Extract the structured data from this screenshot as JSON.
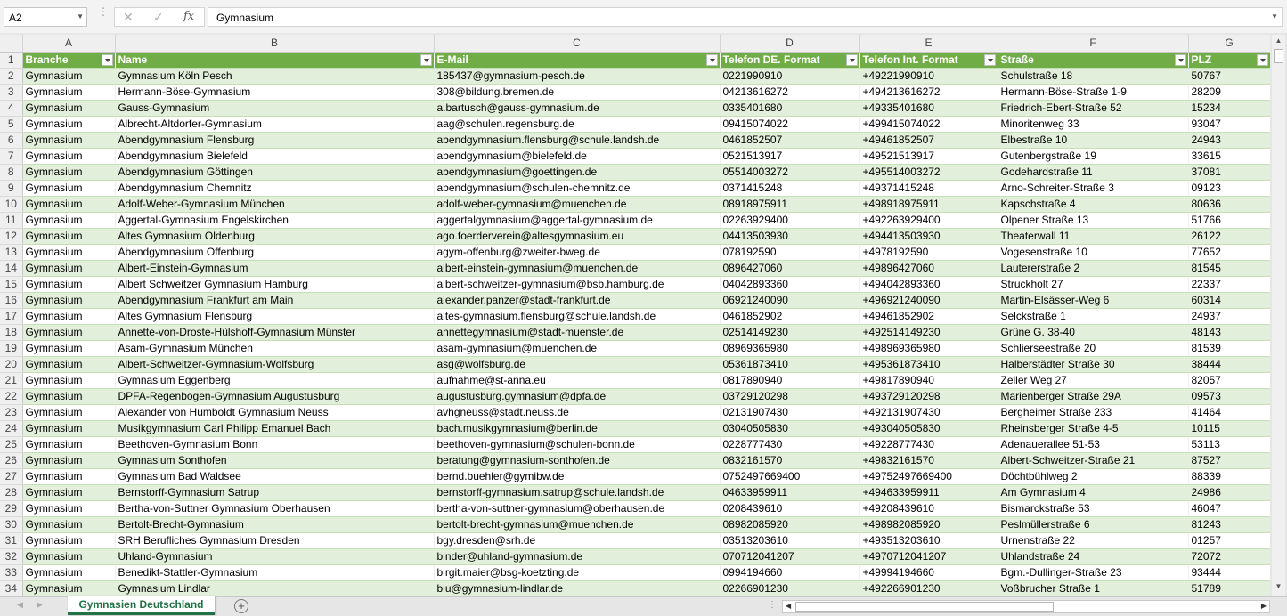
{
  "name_box": "A2",
  "formula": "Gymnasium",
  "column_letters": [
    "A",
    "B",
    "C",
    "D",
    "E",
    "F",
    "G"
  ],
  "headers": [
    "Branche",
    "Name",
    "E-Mail",
    "Telefon DE. Format",
    "Telefon Int. Format",
    "Straße",
    "PLZ"
  ],
  "rows": [
    {
      "n": "2",
      "cells": [
        "Gymnasium",
        "Gymnasium Köln Pesch",
        "185437@gymnasium-pesch.de",
        "0221990910",
        "+49221990910",
        "Schulstraße 18",
        "50767"
      ]
    },
    {
      "n": "3",
      "cells": [
        "Gymnasium",
        "Hermann-Böse-Gymnasium",
        "308@bildung.bremen.de",
        "04213616272",
        "+494213616272",
        "Hermann-Böse-Straße 1-9",
        "28209"
      ]
    },
    {
      "n": "4",
      "cells": [
        "Gymnasium",
        "Gauss-Gymnasium",
        "a.bartusch@gauss-gymnasium.de",
        "0335401680",
        "+49335401680",
        "Friedrich-Ebert-Straße 52",
        "15234"
      ]
    },
    {
      "n": "5",
      "cells": [
        "Gymnasium",
        "Albrecht-Altdorfer-Gymnasium",
        "aag@schulen.regensburg.de",
        "09415074022",
        "+499415074022",
        "Minoritenweg 33",
        "93047"
      ]
    },
    {
      "n": "6",
      "cells": [
        "Gymnasium",
        "Abendgymnasium Flensburg",
        "abendgymnasium.flensburg@schule.landsh.de",
        "0461852507",
        "+49461852507",
        "Elbestraße 10",
        "24943"
      ]
    },
    {
      "n": "7",
      "cells": [
        "Gymnasium",
        "Abendgymnasium Bielefeld",
        "abendgymnasium@bielefeld.de",
        "0521513917",
        "+49521513917",
        "Gutenbergstraße 19",
        "33615"
      ]
    },
    {
      "n": "8",
      "cells": [
        "Gymnasium",
        "Abendgymnasium Göttingen",
        "abendgymnasium@goettingen.de",
        "05514003272",
        "+495514003272",
        "Godehardstraße 11",
        "37081"
      ]
    },
    {
      "n": "9",
      "cells": [
        "Gymnasium",
        "Abendgymnasium Chemnitz",
        "abendgymnasium@schulen-chemnitz.de",
        "0371415248",
        "+49371415248",
        "Arno-Schreiter-Straße 3",
        "09123"
      ]
    },
    {
      "n": "10",
      "cells": [
        "Gymnasium",
        "Adolf-Weber-Gymnasium München",
        "adolf-weber-gymnasium@muenchen.de",
        "08918975911",
        "+498918975911",
        "Kapschstraße 4",
        "80636"
      ]
    },
    {
      "n": "11",
      "cells": [
        "Gymnasium",
        "Aggertal-Gymnasium Engelskirchen",
        "aggertalgymnasium@aggertal-gymnasium.de",
        "02263929400",
        "+492263929400",
        "Olpener Straße 13",
        "51766"
      ]
    },
    {
      "n": "12",
      "cells": [
        "Gymnasium",
        "Altes Gymnasium Oldenburg",
        "ago.foerderverein@altesgymnasium.eu",
        "04413503930",
        "+494413503930",
        "Theaterwall 11",
        "26122"
      ]
    },
    {
      "n": "13",
      "cells": [
        "Gymnasium",
        "Abendgymnasium Offenburg",
        "agym-offenburg@zweiter-bweg.de",
        "078192590",
        "+4978192590",
        "Vogesenstraße 10",
        "77652"
      ]
    },
    {
      "n": "14",
      "cells": [
        "Gymnasium",
        "Albert-Einstein-Gymnasium",
        "albert-einstein-gymnasium@muenchen.de",
        "0896427060",
        "+49896427060",
        "Lautererstraße 2",
        "81545"
      ]
    },
    {
      "n": "15",
      "cells": [
        "Gymnasium",
        "Albert Schweitzer Gymnasium Hamburg",
        "albert-schweitzer-gymnasium@bsb.hamburg.de",
        "04042893360",
        "+494042893360",
        "Struckholt 27",
        "22337"
      ]
    },
    {
      "n": "16",
      "cells": [
        "Gymnasium",
        "Abendgymnasium Frankfurt am Main",
        "alexander.panzer@stadt-frankfurt.de",
        "06921240090",
        "+496921240090",
        "Martin-Elsässer-Weg 6",
        "60314"
      ]
    },
    {
      "n": "17",
      "cells": [
        "Gymnasium",
        "Altes Gymnasium Flensburg",
        "altes-gymnasium.flensburg@schule.landsh.de",
        "0461852902",
        "+49461852902",
        "Selckstraße 1",
        "24937"
      ]
    },
    {
      "n": "18",
      "cells": [
        "Gymnasium",
        "Annette-von-Droste-Hülshoff-Gymnasium Münster",
        "annettegymnasium@stadt-muenster.de",
        "02514149230",
        "+492514149230",
        "Grüne G. 38-40",
        "48143"
      ]
    },
    {
      "n": "19",
      "cells": [
        "Gymnasium",
        "Asam-Gymnasium München",
        "asam-gymnasium@muenchen.de",
        "08969365980",
        "+498969365980",
        "Schlierseestraße 20",
        "81539"
      ]
    },
    {
      "n": "20",
      "cells": [
        "Gymnasium",
        "Albert-Schweitzer-Gymnasium-Wolfsburg",
        "asg@wolfsburg.de",
        "05361873410",
        "+495361873410",
        "Halberstädter Straße 30",
        "38444"
      ]
    },
    {
      "n": "21",
      "cells": [
        "Gymnasium",
        "Gymnasium Eggenberg",
        "aufnahme@st-anna.eu",
        "0817890940",
        "+49817890940",
        "Zeller Weg 27",
        "82057"
      ]
    },
    {
      "n": "22",
      "cells": [
        "Gymnasium",
        "DPFA-Regenbogen-Gymnasium Augustusburg",
        "augustusburg.gymnasium@dpfa.de",
        "03729120298",
        "+493729120298",
        "Marienberger Straße 29A",
        "09573"
      ]
    },
    {
      "n": "23",
      "cells": [
        "Gymnasium",
        "Alexander von Humboldt Gymnasium Neuss",
        "avhgneuss@stadt.neuss.de",
        "02131907430",
        "+492131907430",
        "Bergheimer Straße 233",
        "41464"
      ]
    },
    {
      "n": "24",
      "cells": [
        "Gymnasium",
        "Musikgymnasium Carl Philipp Emanuel Bach",
        "bach.musikgymnasium@berlin.de",
        "03040505830",
        "+493040505830",
        "Rheinsberger Straße 4-5",
        "10115"
      ]
    },
    {
      "n": "25",
      "cells": [
        "Gymnasium",
        "Beethoven-Gymnasium Bonn",
        "beethoven-gymnasium@schulen-bonn.de",
        "0228777430",
        "+49228777430",
        "Adenauerallee 51-53",
        "53113"
      ]
    },
    {
      "n": "26",
      "cells": [
        "Gymnasium",
        "Gymnasium Sonthofen",
        "beratung@gymnasium-sonthofen.de",
        "0832161570",
        "+49832161570",
        "Albert-Schweitzer-Straße 21",
        "87527"
      ]
    },
    {
      "n": "27",
      "cells": [
        "Gymnasium",
        "Gymnasium Bad Waldsee",
        "bernd.buehler@gymibw.de",
        "0752497669400",
        "+49752497669400",
        "Döchtbühlweg 2",
        "88339"
      ]
    },
    {
      "n": "28",
      "cells": [
        "Gymnasium",
        "Bernstorff-Gymnasium Satrup",
        "bernstorff-gymnasium.satrup@schule.landsh.de",
        "04633959911",
        "+494633959911",
        "Am Gymnasium 4",
        "24986"
      ]
    },
    {
      "n": "29",
      "cells": [
        "Gymnasium",
        "Bertha-von-Suttner Gymnasium Oberhausen",
        "bertha-von-suttner-gymnasium@oberhausen.de",
        "0208439610",
        "+49208439610",
        "Bismarckstraße 53",
        "46047"
      ]
    },
    {
      "n": "30",
      "cells": [
        "Gymnasium",
        "Bertolt-Brecht-Gymnasium",
        "bertolt-brecht-gymnasium@muenchen.de",
        "08982085920",
        "+498982085920",
        "Peslmüllerstraße 6",
        "81243"
      ]
    },
    {
      "n": "31",
      "cells": [
        "Gymnasium",
        "SRH Berufliches Gymnasium Dresden",
        "bgy.dresden@srh.de",
        "03513203610",
        "+493513203610",
        "Urnenstraße 22",
        "01257"
      ]
    },
    {
      "n": "32",
      "cells": [
        "Gymnasium",
        "Uhland-Gymnasium",
        "binder@uhland-gymnasium.de",
        "070712041207",
        "+4970712041207",
        "Uhlandstraße 24",
        "72072"
      ]
    },
    {
      "n": "33",
      "cells": [
        "Gymnasium",
        "Benedikt-Stattler-Gymnasium",
        "birgit.maier@bsg-koetzting.de",
        "0994194660",
        "+49994194660",
        "Bgm.-Dullinger-Straße 23",
        "93444"
      ]
    },
    {
      "n": "34",
      "cells": [
        "Gymnasium",
        "Gymnasium Lindlar",
        "blu@gymnasium-lindlar.de",
        "02266901230",
        "+492266901230",
        "Voßbrucher Straße 1",
        "51789"
      ]
    }
  ],
  "sheet_tab": "Gymnasien Deutschland",
  "colors": {
    "header_green": "#70ad47",
    "band_green": "#e2efda",
    "tab_green": "#217346"
  }
}
